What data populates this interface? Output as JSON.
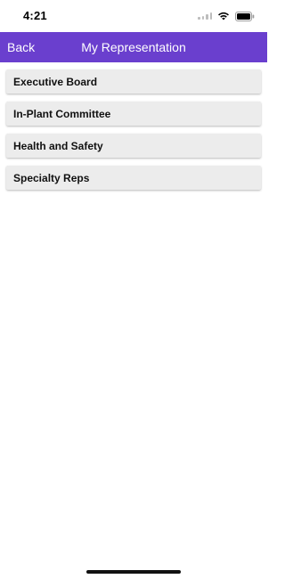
{
  "status_bar": {
    "time": "4:21",
    "icons": [
      "cellular-signal-icon",
      "wifi-icon",
      "battery-icon"
    ]
  },
  "nav": {
    "back_label": "Back",
    "title": "My Representation",
    "background_color": "#6a3fce"
  },
  "menu": {
    "items": [
      {
        "label": "Executive Board"
      },
      {
        "label": "In-Plant Committee"
      },
      {
        "label": "Health and Safety"
      },
      {
        "label": "Specialty Reps"
      }
    ]
  }
}
